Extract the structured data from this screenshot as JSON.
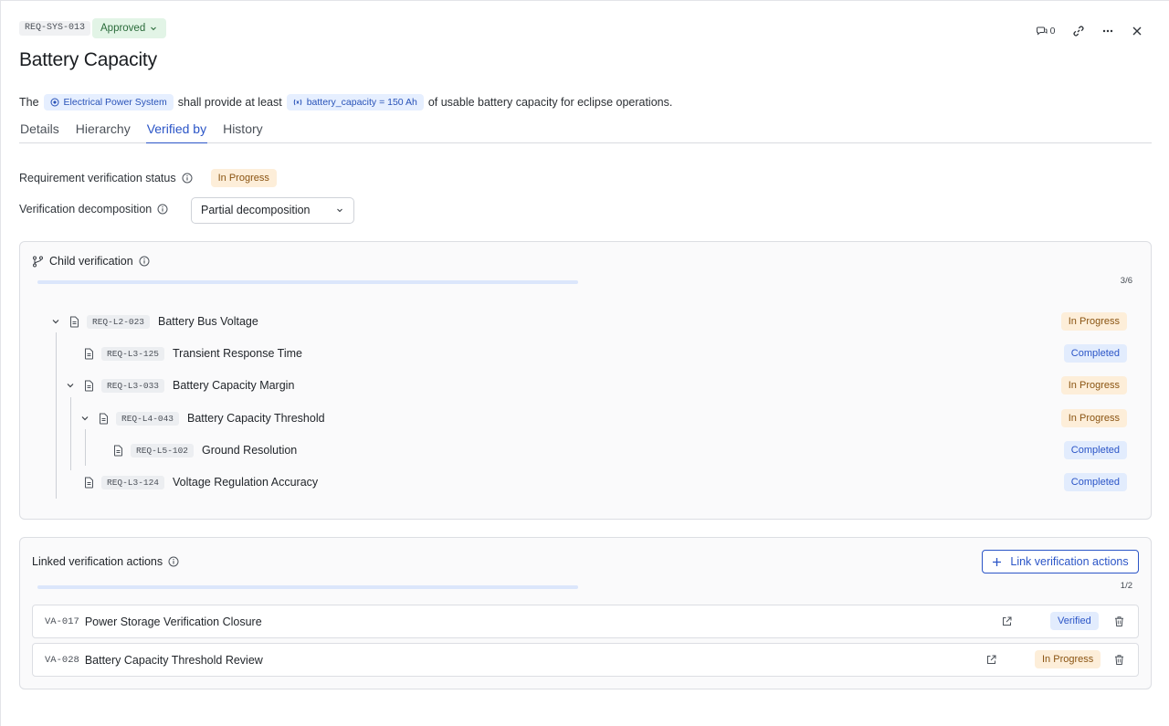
{
  "header": {
    "requirement_id": "REQ-SYS-013",
    "status": "Approved",
    "title": "Battery Capacity",
    "comment_count": "0"
  },
  "statement": {
    "prefix": "The",
    "system_pill": "Electrical Power System",
    "middle": "shall provide at least",
    "param_pill": "battery_capacity = 150 Ah",
    "suffix": "of usable battery capacity for eclipse operations."
  },
  "tabs": [
    "Details",
    "Hierarchy",
    "Verified by",
    "History"
  ],
  "active_tab": "Verified by",
  "verification": {
    "status_label": "Requirement verification status",
    "status_value": "In Progress",
    "decomposition_label": "Verification decomposition",
    "decomposition_value": "Partial decomposition"
  },
  "child_verification": {
    "title": "Child verification",
    "progress": 0.5,
    "count": "3/6",
    "items": [
      {
        "id": "REQ-L2-023",
        "name": "Battery Bus Voltage",
        "status": "In Progress",
        "level": 0,
        "expandable": true
      },
      {
        "id": "REQ-L3-125",
        "name": "Transient Response Time",
        "status": "Completed",
        "level": 1,
        "expandable": false
      },
      {
        "id": "REQ-L3-033",
        "name": "Battery Capacity Margin",
        "status": "In Progress",
        "level": 1,
        "expandable": true
      },
      {
        "id": "REQ-L4-043",
        "name": "Battery Capacity Threshold",
        "status": "In Progress",
        "level": 2,
        "expandable": true
      },
      {
        "id": "REQ-L5-102",
        "name": "Ground Resolution",
        "status": "Completed",
        "level": 3,
        "expandable": false
      },
      {
        "id": "REQ-L3-124",
        "name": "Voltage Regulation Accuracy",
        "status": "Completed",
        "level": 1,
        "expandable": false
      }
    ]
  },
  "linked_actions": {
    "title": "Linked verification actions",
    "link_button": "Link verification actions",
    "progress": 0.5,
    "count": "1/2",
    "items": [
      {
        "id": "VA-017",
        "name": "Power Storage Verification Closure",
        "status": "Verified"
      },
      {
        "id": "VA-028",
        "name": "Battery Capacity Threshold Review",
        "status": "In Progress"
      }
    ]
  },
  "colors": {
    "accent": "#2b55c7",
    "approved_bg": "#e2f4e6",
    "in_progress_bg": "#fdeed9",
    "completed_bg": "#e2ecfd"
  }
}
